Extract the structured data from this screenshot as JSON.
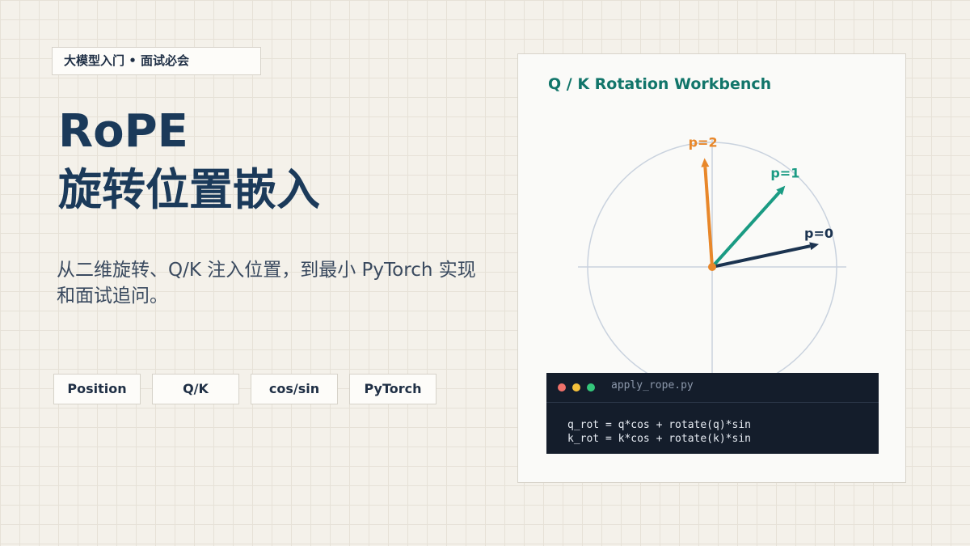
{
  "tag": "大模型入门 • 面试必会",
  "title_line1": "RoPE",
  "title_line2": "旋转位置嵌入",
  "description": "从二维旋转、Q/K 注入位置，到最小 PyTorch 实现和面试追问。",
  "chips": [
    "Position",
    "Q/K",
    "cos/sin",
    "PyTorch"
  ],
  "panel": {
    "title": "Q / K Rotation Workbench",
    "vectors": [
      {
        "label": "p=0",
        "angle_deg": 12,
        "color": "#1b3350"
      },
      {
        "label": "p=1",
        "angle_deg": 48,
        "color": "#1a9b83"
      },
      {
        "label": "p=2",
        "angle_deg": 94,
        "color": "#e8872a"
      }
    ],
    "colors": {
      "circle": "#c9d2de",
      "origin": "#e8872a"
    }
  },
  "code": {
    "filename": "apply_rope.py",
    "lines": [
      "q_rot = q*cos + rotate(q)*sin",
      "k_rot = k*cos + rotate(k)*sin"
    ]
  }
}
